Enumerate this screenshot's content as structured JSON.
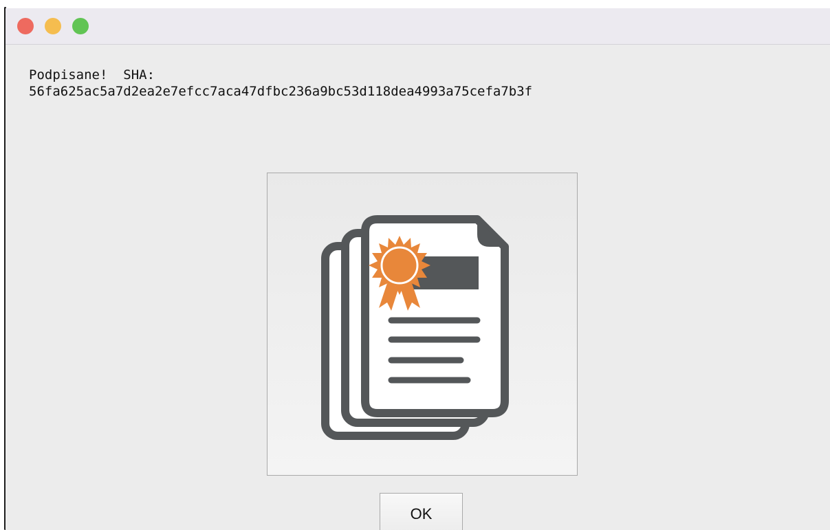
{
  "window": {
    "controls": {
      "close_color": "#ee6a5f",
      "minimize_color": "#f5bd4f",
      "zoom_color": "#61c454"
    }
  },
  "dialog": {
    "message_line1": "Podpisane!  SHA:",
    "message_line2": "56fa625ac5a7d2ea2e7efcc7aca47dfbc236a9bc53d118dea4993a75cefa7b3f",
    "icon": "certificate-documents-icon",
    "ok_label": "OK"
  },
  "colors": {
    "icon_gray": "#545759",
    "seal_orange": "#e8873a"
  }
}
